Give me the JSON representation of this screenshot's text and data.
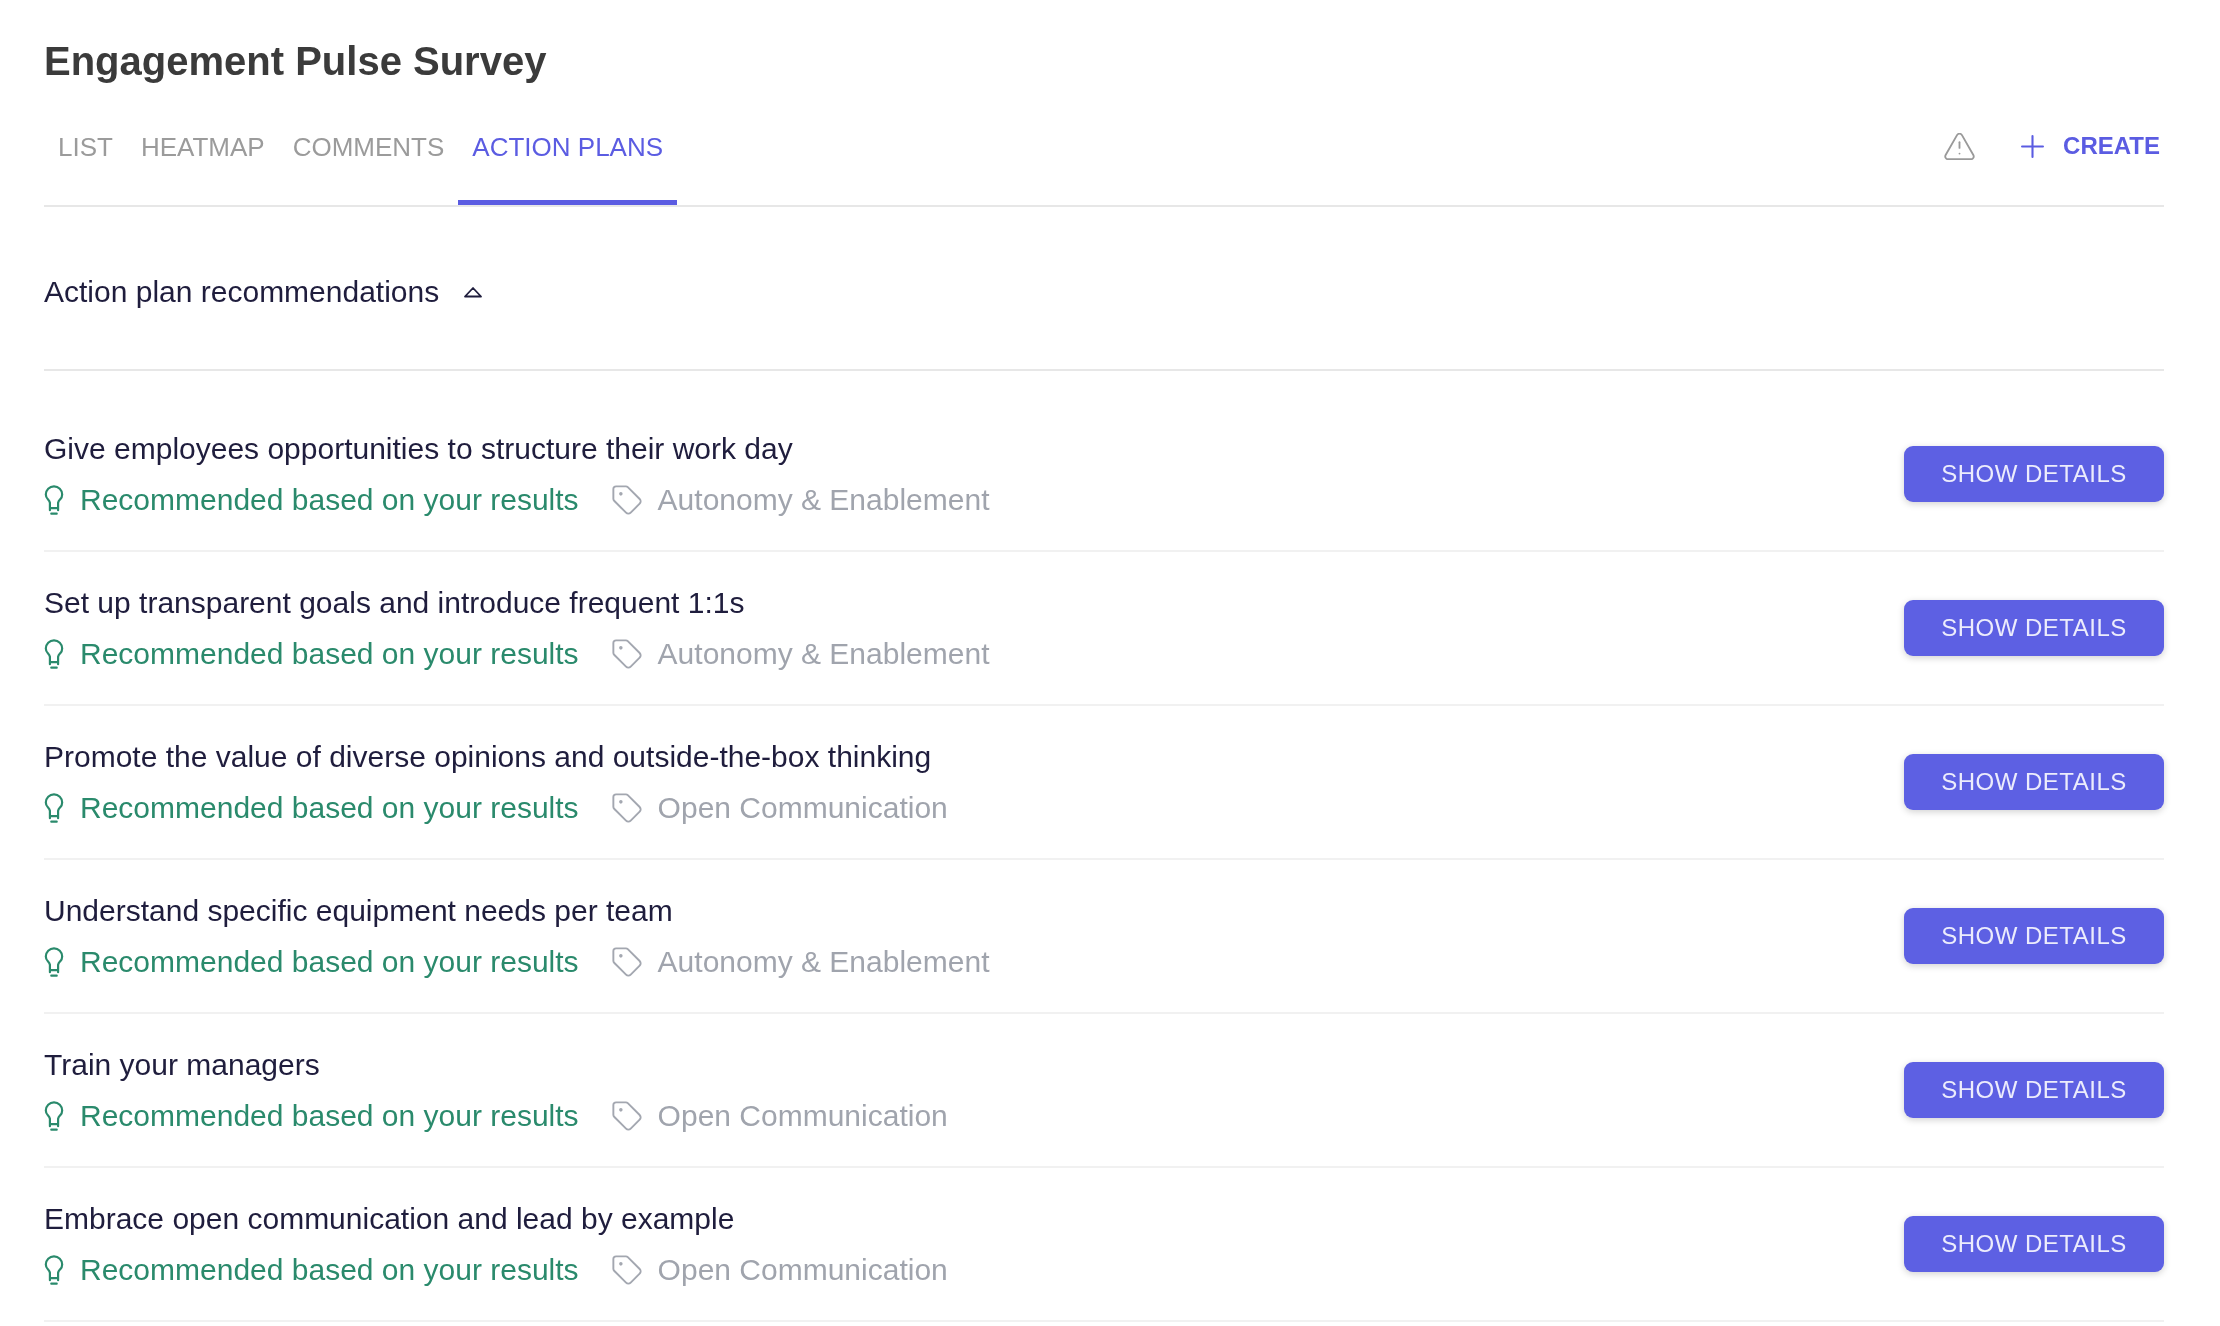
{
  "page": {
    "title": "Engagement Pulse Survey"
  },
  "tabs": [
    {
      "label": "LIST",
      "selected": false
    },
    {
      "label": "HEATMAP",
      "selected": false
    },
    {
      "label": "COMMENTS",
      "selected": false
    },
    {
      "label": "ACTION PLANS",
      "selected": true
    }
  ],
  "toolbar": {
    "create_button": "CREATE"
  },
  "recommendations": {
    "heading": "Action plan recommendations",
    "expanded": true,
    "items": [
      {
        "title": "Give employees opportunities to structure their work day",
        "reason": "Recommended based on your results",
        "tag": "Autonomy & Enablement",
        "button": "SHOW DETAILS"
      },
      {
        "title": "Set up transparent goals and introduce frequent 1:1s",
        "reason": "Recommended based on your results",
        "tag": "Autonomy & Enablement",
        "button": "SHOW DETAILS"
      },
      {
        "title": "Promote the value of diverse opinions and outside-the-box thinking",
        "reason": "Recommended based on your results",
        "tag": "Open Communication",
        "button": "SHOW DETAILS"
      },
      {
        "title": "Understand specific equipment needs per team",
        "reason": "Recommended based on your results",
        "tag": "Autonomy & Enablement",
        "button": "SHOW DETAILS"
      },
      {
        "title": "Train your managers",
        "reason": "Recommended based on your results",
        "tag": "Open Communication",
        "button": "SHOW DETAILS"
      },
      {
        "title": "Embrace open communication and lead by example",
        "reason": "Recommended based on your results",
        "tag": "Open Communication",
        "button": "SHOW DETAILS"
      }
    ]
  }
}
